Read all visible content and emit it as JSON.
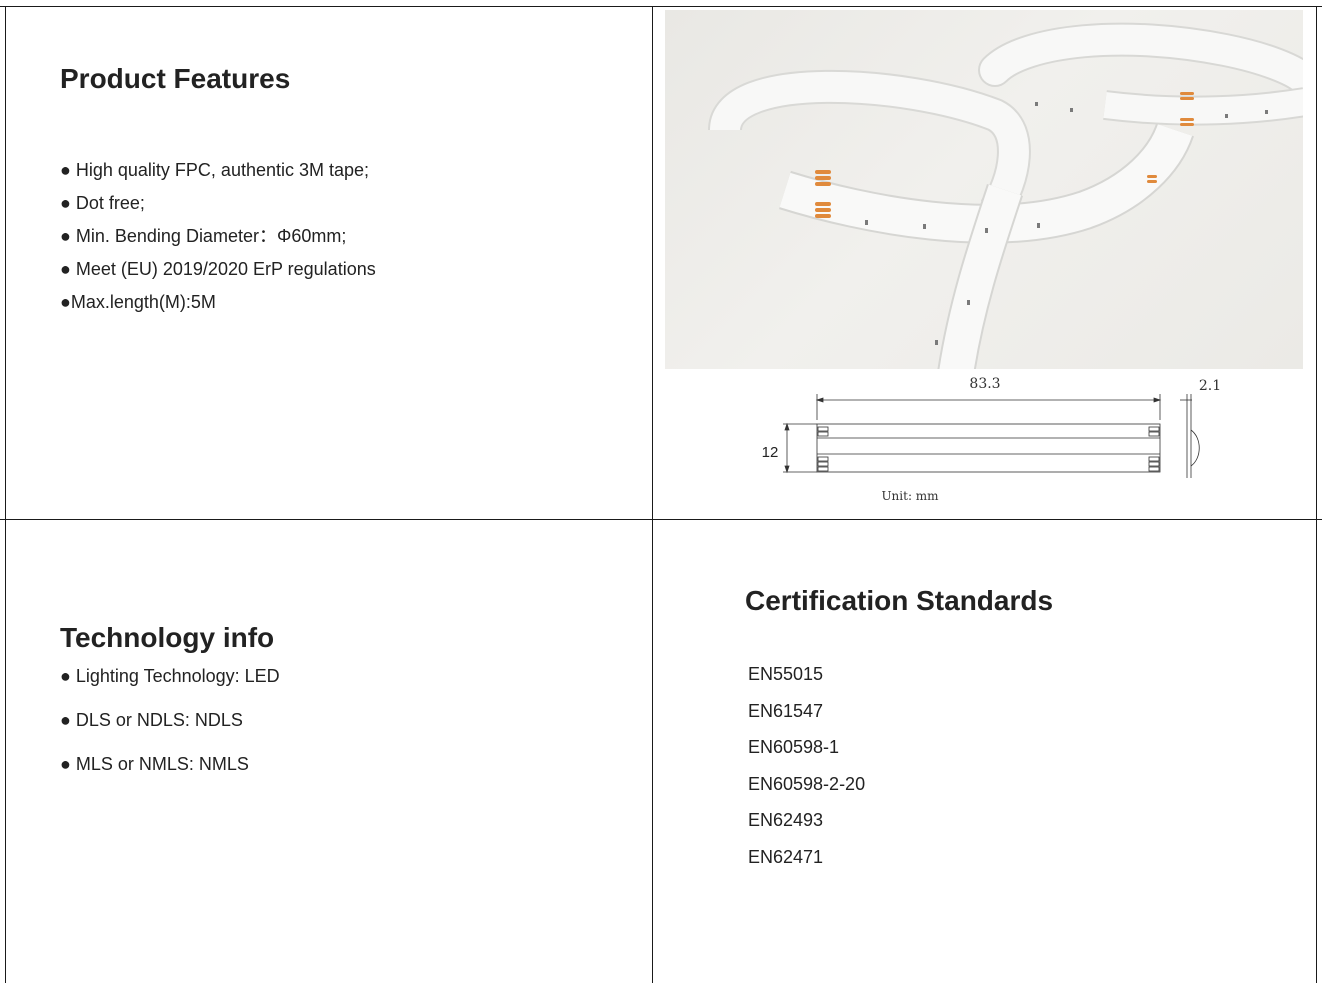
{
  "features": {
    "title": "Product Features",
    "items": [
      "● High quality FPC, authentic 3M tape;",
      "● Dot free;",
      "● Min. Bending Diameter：Φ60mm;",
      "● Meet (EU) 2019/2020 ErP regulations",
      "●Max.length(M):5M"
    ]
  },
  "drawing": {
    "length": "83.3",
    "thickness": "2.1",
    "width": "12",
    "unit": "Unit: mm"
  },
  "tech": {
    "title": "Technology info",
    "items": [
      "● Lighting Technology: LED",
      "● DLS or NDLS: NDLS",
      "● MLS or NMLS: NMLS"
    ]
  },
  "cert": {
    "title": "Certification Standards",
    "items": [
      "EN55015",
      "EN61547",
      "EN60598-1",
      "EN60598-2-20",
      "EN62493",
      "EN62471"
    ]
  },
  "colors": {
    "border": "#1a1a1a",
    "pad": "#e08a3c",
    "strip": "#f7f7f6"
  }
}
